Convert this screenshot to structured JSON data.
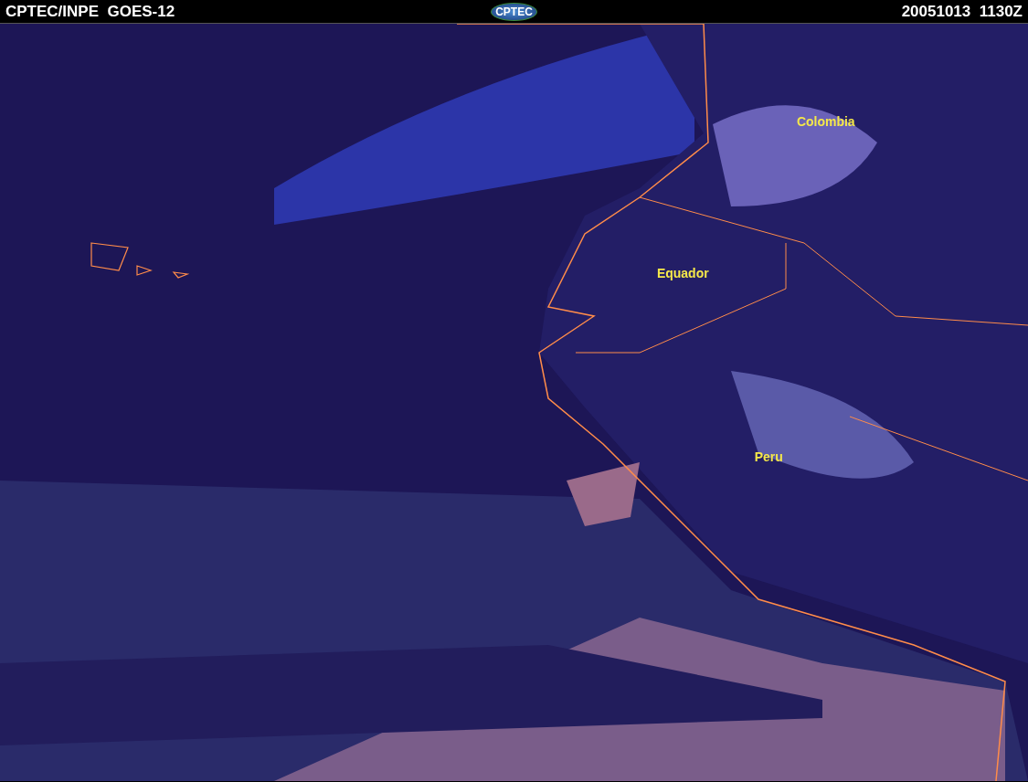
{
  "header": {
    "title": "CPTEC/INPE  GOES-12",
    "logo": "CPTEC",
    "timestamp": "20051013  1130Z"
  },
  "map": {
    "labels": [
      {
        "text": "Colombia"
      },
      {
        "text": "Equador"
      },
      {
        "text": "Peru"
      }
    ]
  }
}
